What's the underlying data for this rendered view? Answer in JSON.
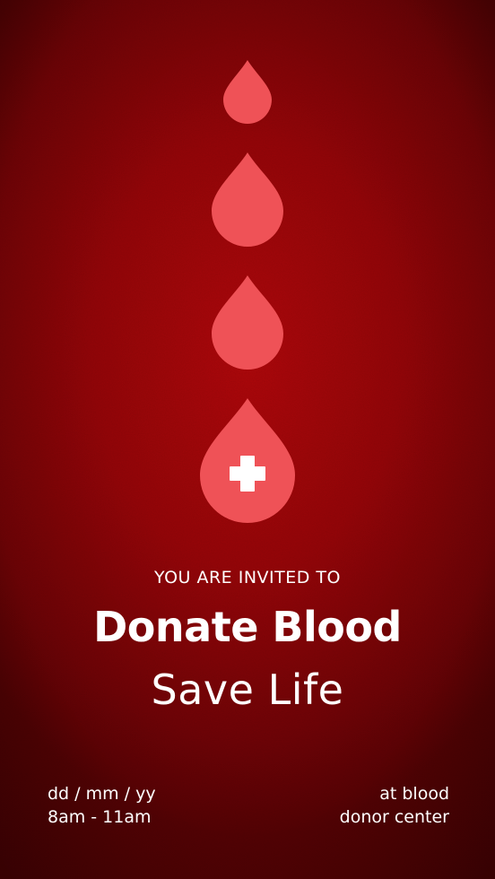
{
  "invite_text": "YOU ARE INVITED TO",
  "title": "Donate Blood",
  "subtitle": "Save Life",
  "event": {
    "date": "dd / mm / yy",
    "time": "8am - 11am",
    "location_line1": "at blood",
    "location_line2": "donor center"
  },
  "colors": {
    "background": "#9e0508",
    "drop": "#ef5257",
    "text": "#ffffff"
  },
  "icons": [
    "blood-drop-icon",
    "blood-drop-icon",
    "blood-drop-icon",
    "medical-cross-icon"
  ]
}
